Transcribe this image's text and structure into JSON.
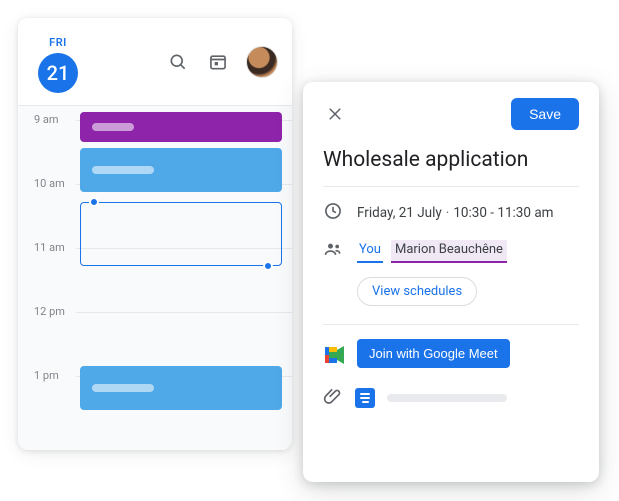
{
  "calendar": {
    "dayLabel": "FRI",
    "dayNumber": "21",
    "times": [
      "9 am",
      "10 am",
      "11 am",
      "12 pm",
      "1 pm"
    ]
  },
  "detail": {
    "saveLabel": "Save",
    "title": "Wholesale application",
    "dateText": "Friday, 21 July",
    "timeText": "10:30 - 11:30 am",
    "youLabel": "You",
    "guestName": "Marion Beauchêne",
    "viewSchedules": "View schedules",
    "joinLabel": "Join with Google Meet"
  }
}
